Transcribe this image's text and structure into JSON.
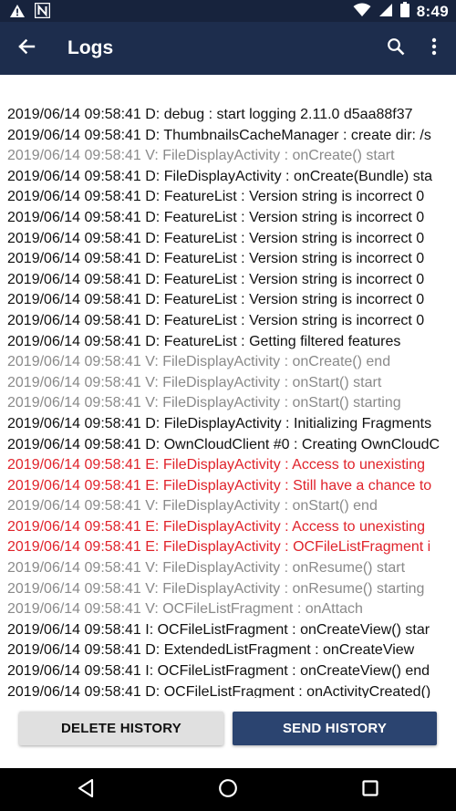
{
  "status_bar": {
    "time": "8:49",
    "icons": [
      "warning-icon",
      "n-notification-icon",
      "wifi-icon",
      "signal-icon",
      "battery-icon"
    ]
  },
  "app_bar": {
    "title": "Logs",
    "icons": [
      "back-arrow-icon",
      "search-icon",
      "more-vert-icon"
    ]
  },
  "logs": [
    {
      "level": "D",
      "text": "2019/06/14 09:58:41 D: debug : start logging 2.11.0 d5aa88f37"
    },
    {
      "level": "D",
      "text": "2019/06/14 09:58:41 D: ThumbnailsCacheManager : create dir: /s"
    },
    {
      "level": "V",
      "text": "2019/06/14 09:58:41 V: FileDisplayActivity : onCreate() start"
    },
    {
      "level": "D",
      "text": "2019/06/14 09:58:41 D: FileDisplayActivity : onCreate(Bundle) sta"
    },
    {
      "level": "D",
      "text": "2019/06/14 09:58:41 D: FeatureList : Version string is incorrect 0"
    },
    {
      "level": "D",
      "text": "2019/06/14 09:58:41 D: FeatureList : Version string is incorrect 0"
    },
    {
      "level": "D",
      "text": "2019/06/14 09:58:41 D: FeatureList : Version string is incorrect 0"
    },
    {
      "level": "D",
      "text": "2019/06/14 09:58:41 D: FeatureList : Version string is incorrect 0"
    },
    {
      "level": "D",
      "text": "2019/06/14 09:58:41 D: FeatureList : Version string is incorrect 0"
    },
    {
      "level": "D",
      "text": "2019/06/14 09:58:41 D: FeatureList : Version string is incorrect 0"
    },
    {
      "level": "D",
      "text": "2019/06/14 09:58:41 D: FeatureList : Version string is incorrect 0"
    },
    {
      "level": "D",
      "text": "2019/06/14 09:58:41 D: FeatureList : Getting filtered features"
    },
    {
      "level": "V",
      "text": "2019/06/14 09:58:41 V: FileDisplayActivity : onCreate() end"
    },
    {
      "level": "V",
      "text": "2019/06/14 09:58:41 V: FileDisplayActivity : onStart() start"
    },
    {
      "level": "V",
      "text": "2019/06/14 09:58:41 V: FileDisplayActivity : onStart() starting"
    },
    {
      "level": "D",
      "text": "2019/06/14 09:58:41 D: FileDisplayActivity : Initializing Fragments"
    },
    {
      "level": "D",
      "text": "2019/06/14 09:58:41 D: OwnCloudClient #0 : Creating OwnCloudC"
    },
    {
      "level": "E",
      "text": "2019/06/14 09:58:41 E: FileDisplayActivity : Access to unexisting"
    },
    {
      "level": "E",
      "text": "2019/06/14 09:58:41 E: FileDisplayActivity : Still have a chance to"
    },
    {
      "level": "V",
      "text": "2019/06/14 09:58:41 V: FileDisplayActivity : onStart() end"
    },
    {
      "level": "E",
      "text": "2019/06/14 09:58:41 E: FileDisplayActivity : Access to unexisting"
    },
    {
      "level": "E",
      "text": "2019/06/14 09:58:41 E: FileDisplayActivity : OCFileListFragment i"
    },
    {
      "level": "V",
      "text": "2019/06/14 09:58:41 V: FileDisplayActivity : onResume() start"
    },
    {
      "level": "V",
      "text": "2019/06/14 09:58:41 V: FileDisplayActivity : onResume() starting"
    },
    {
      "level": "V",
      "text": "2019/06/14 09:58:41 V: OCFileListFragment : onAttach"
    },
    {
      "level": "I",
      "text": "2019/06/14 09:58:41 I: OCFileListFragment : onCreateView() star"
    },
    {
      "level": "D",
      "text": "2019/06/14 09:58:41 D: ExtendedListFragment : onCreateView"
    },
    {
      "level": "I",
      "text": "2019/06/14 09:58:41 I: OCFileListFragment : onCreateView() end"
    },
    {
      "level": "D",
      "text": "2019/06/14 09:58:41 D: OCFileListFragment : onActivityCreated()"
    }
  ],
  "buttons": {
    "delete_label": "DELETE HISTORY",
    "send_label": "SEND HISTORY"
  },
  "nav_bar": {
    "icons": [
      "nav-back-icon",
      "nav-home-icon",
      "nav-recents-icon"
    ]
  },
  "colors": {
    "status_bar": "#17233d",
    "app_bar": "#1d2d4d",
    "send_button": "#2b4470",
    "delete_button": "#e0e0e0",
    "log_error": "#e0232b",
    "log_verbose": "#8a8a8a",
    "log_default": "#111111"
  }
}
